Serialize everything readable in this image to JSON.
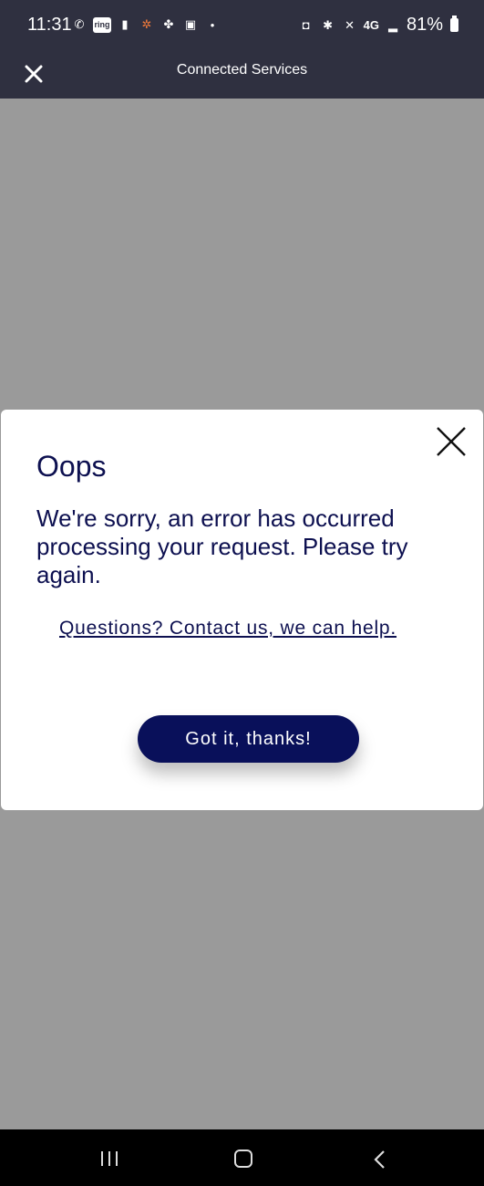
{
  "status_bar": {
    "time": "11:31",
    "left_icons": [
      "whatsapp-icon",
      "ring-icon",
      "notification-icon",
      "app-icon",
      "pinwheel-icon",
      "gallery-icon",
      "dot-icon"
    ],
    "ring_label": "ring",
    "network": "4G",
    "battery": "81%"
  },
  "header": {
    "title": "Connected Services"
  },
  "dialog": {
    "title": "Oops",
    "message": "We're sorry, an error has occurred processing your request. Please try again.",
    "link_text": "Questions? Contact us, we can help.",
    "button_label": "Got it, thanks!"
  },
  "colors": {
    "header_bg": "#2f3040",
    "backdrop": "#9a9a9a",
    "primary_text": "#0d1050",
    "button_bg": "#09105a"
  }
}
